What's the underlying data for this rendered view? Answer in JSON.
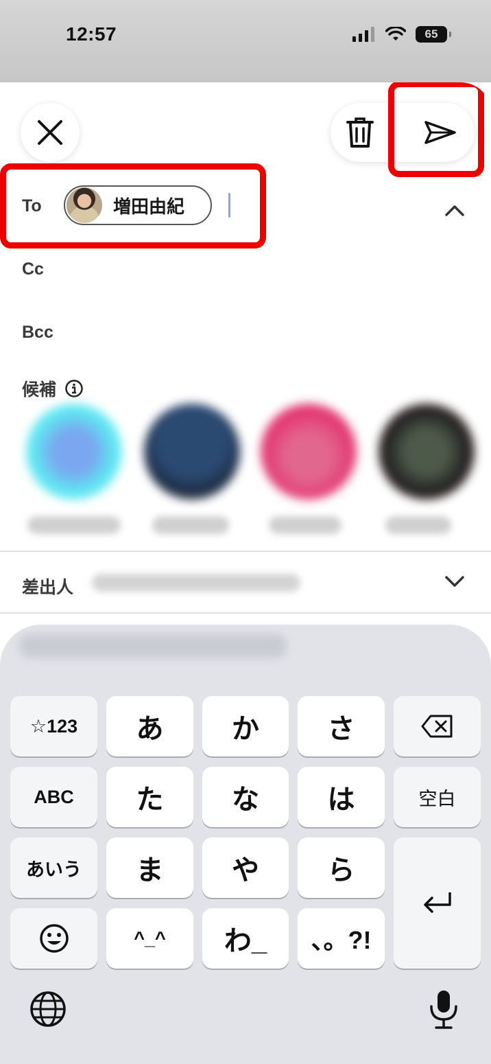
{
  "status": {
    "time": "12:57",
    "battery": "65"
  },
  "compose": {
    "to_label": "To",
    "recipient_name": "増田由紀",
    "cc_label": "Cc",
    "bcc_label": "Bcc",
    "suggestions_label": "候補",
    "from_label": "差出人"
  },
  "highlight_color": "#ee0000",
  "icons": [
    "close-icon",
    "trash-icon",
    "send-icon",
    "chevron-up-icon",
    "info-icon",
    "chevron-down-icon",
    "backspace-icon",
    "return-icon",
    "emoji-icon",
    "globe-icon",
    "microphone-icon"
  ],
  "keyboard": {
    "rows": [
      [
        "☆123",
        "あ",
        "か",
        "さ"
      ],
      [
        "ABC",
        "た",
        "な",
        "は",
        "空白"
      ],
      [
        "あいう",
        "ま",
        "や",
        "ら"
      ],
      [
        "^_^",
        "わ_",
        "、。?!"
      ]
    ],
    "k_sym": "☆123",
    "k_a": "あ",
    "k_ka": "か",
    "k_sa": "さ",
    "k_abc": "ABC",
    "k_ta": "た",
    "k_na": "な",
    "k_ha": "は",
    "k_space": "空白",
    "k_aiu": "あいう",
    "k_ma": "ま",
    "k_ya": "や",
    "k_ra": "ら",
    "k_kao": "^_^",
    "k_wa": "わ_",
    "k_punct": "、。?!"
  }
}
